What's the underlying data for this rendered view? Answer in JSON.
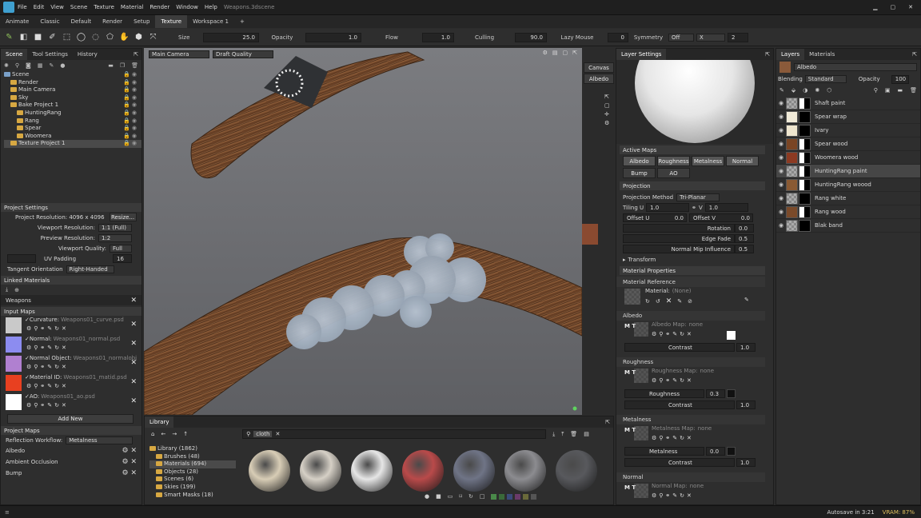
{
  "menu": [
    "File",
    "Edit",
    "View",
    "Scene",
    "Texture",
    "Material",
    "Render",
    "Window",
    "Help"
  ],
  "title": "Weapons.3dscene",
  "workspaces": [
    "Animate",
    "Classic",
    "Default",
    "Render",
    "Setup",
    "Texture",
    "Workspace 1",
    "+"
  ],
  "toolbar": {
    "size_label": "Size",
    "size_val": "25.0",
    "opacity_label": "Opacity",
    "opacity_val": "1.0",
    "flow_label": "Flow",
    "flow_val": "1.0",
    "culling_label": "Culling",
    "culling_val": "90.0",
    "lazy_label": "Lazy Mouse",
    "lazy_val": "0",
    "sym_label": "Symmetry",
    "sym_val": "Off",
    "sym_axis": "X",
    "sym_count": "2"
  },
  "left_tabs": [
    "Scene",
    "Tool Settings",
    "History"
  ],
  "scene_tree": [
    {
      "t": "Scene",
      "d": 0
    },
    {
      "t": "Render",
      "d": 1
    },
    {
      "t": "Main Camera",
      "d": 1
    },
    {
      "t": "Sky",
      "d": 1
    },
    {
      "t": "Bake Project 1",
      "d": 1
    },
    {
      "t": "HuntingRang",
      "d": 2
    },
    {
      "t": "Rang",
      "d": 2
    },
    {
      "t": "Spear",
      "d": 2
    },
    {
      "t": "Woomera",
      "d": 2
    },
    {
      "t": "Texture Project 1",
      "d": 1
    }
  ],
  "project_settings": {
    "header": "Project Settings",
    "res_label": "Project Resolution: 4096 x 4096",
    "resize": "Resize...",
    "viewport_res_label": "Viewport Resolution:",
    "viewport_res": "1:1 (Full)",
    "preview_res_label": "Preview Resolution:",
    "preview_res": "1:2",
    "viewport_q_label": "Viewport Quality:",
    "viewport_q": "Full",
    "uv_label": "UV Padding",
    "uv_val": "16",
    "tangent_label": "Tangent Orientation",
    "tangent_val": "Right-Handed"
  },
  "linked": {
    "header": "Linked Materials",
    "item": "Weapons"
  },
  "input_maps": {
    "header": "Input Maps",
    "items": [
      {
        "label": "Curvature:",
        "file": "Weapons01_curve.psd",
        "sw": "#c9c9c9"
      },
      {
        "label": "Normal:",
        "file": "Weapons01_normal.psd",
        "sw": "#8c8cf0"
      },
      {
        "label": "Normal Object:",
        "file": "Weapons01_normalobj.psd",
        "sw": "#b080d0"
      },
      {
        "label": "Material ID:",
        "file": "Weapons01_matid.psd",
        "sw": "#e84020"
      },
      {
        "label": "AO:",
        "file": "Weapons01_ao.psd",
        "sw": "#ffffff"
      }
    ],
    "add": "Add New"
  },
  "project_maps": {
    "header": "Project Maps",
    "workflow_label": "Reflection Workflow:",
    "workflow": "Metalness",
    "items": [
      "Albedo",
      "Ambient Occlusion",
      "Bump"
    ]
  },
  "viewport": {
    "camera": "Main Camera",
    "quality": "Draft Quality",
    "side_tabs": [
      "Canvas",
      "Albedo"
    ]
  },
  "library": {
    "title": "Library",
    "search": "cloth",
    "tree": [
      {
        "t": "Library (1862)",
        "d": 0
      },
      {
        "t": "Brushes (48)",
        "d": 1
      },
      {
        "t": "Materials (694)",
        "d": 1
      },
      {
        "t": "Objects (28)",
        "d": 1
      },
      {
        "t": "Scenes (6)",
        "d": 1
      },
      {
        "t": "Skies (199)",
        "d": 1
      },
      {
        "t": "Smart Masks (18)",
        "d": 1
      }
    ],
    "balls": [
      "#d8cdb6",
      "#d6d0c6",
      "#e6e6e6",
      "#b94a4a",
      "#6f7486",
      "#8c8c90",
      "#58595d"
    ]
  },
  "layer_settings": {
    "title": "Layer Settings",
    "active_maps": "Active Maps",
    "maps": [
      "Albedo",
      "Roughness",
      "Metalness",
      "Normal",
      "Bump",
      "AO"
    ],
    "projection": "Projection",
    "proj_method_label": "Projection Method",
    "proj_method": "Tri-Planar",
    "tiling_label": "Tiling U",
    "tiling_u": "1.0",
    "tiling_v_label": "V",
    "tiling_v": "1.0",
    "offsetu_label": "Offset U",
    "offsetu": "0.0",
    "offsetv_label": "Offset V",
    "offsetv": "0.0",
    "rotation_label": "Rotation",
    "rotation": "0.0",
    "edgefade_label": "Edge Fade",
    "edgefade": "0.5",
    "normalmip_label": "Normal Mip Influence",
    "normalmip": "0.5",
    "transform": "Transform",
    "mat_props": "Material Properties",
    "mat_ref": "Material Reference",
    "material_label": "Material:",
    "material_val": "(None)",
    "albedo": "Albedo",
    "albedo_map": "Albedo Map:",
    "none": "none",
    "contrast": "Contrast",
    "contrast_val": "1.0",
    "roughness": "Roughness",
    "roughness_map": "Roughness Map:",
    "roughness_label": "Roughness",
    "roughness_val": "0.3",
    "metalness": "Metalness",
    "metalness_map": "Metalness Map:",
    "metalness_label": "Metalness",
    "metalness_val": "0.0",
    "normal": "Normal",
    "normal_map": "Normal Map:"
  },
  "layers": {
    "tabs": [
      "Layers",
      "Materials"
    ],
    "channel": "Albedo",
    "blending_label": "Blending",
    "blending": "Standard",
    "opacity_label": "Opacity",
    "opacity": "100",
    "items": [
      {
        "name": "Shaft paint",
        "sw": "checker",
        "mask": true
      },
      {
        "name": "Spear wrap",
        "sw": "#f0ead8",
        "mask": false
      },
      {
        "name": "Ivary",
        "sw": "#efe6cf",
        "mask": false
      },
      {
        "name": "Spear wood",
        "sw": "#7a4524",
        "mask": true
      },
      {
        "name": "Woomera wood",
        "sw": "#8c3a22",
        "mask": true
      },
      {
        "name": "HuntingRang paint",
        "sw": "checker",
        "mask": true
      },
      {
        "name": "HuntingRang woood",
        "sw": "#8a5a33",
        "mask": true
      },
      {
        "name": "Rang white",
        "sw": "checker",
        "mask": false
      },
      {
        "name": "Rang wood",
        "sw": "#7a4a2a",
        "mask": true
      },
      {
        "name": "Blak band",
        "sw": "checker",
        "mask": false
      }
    ]
  },
  "status": {
    "autosave": "Autosave in 3:21",
    "vram": "VRAM: 87%"
  }
}
